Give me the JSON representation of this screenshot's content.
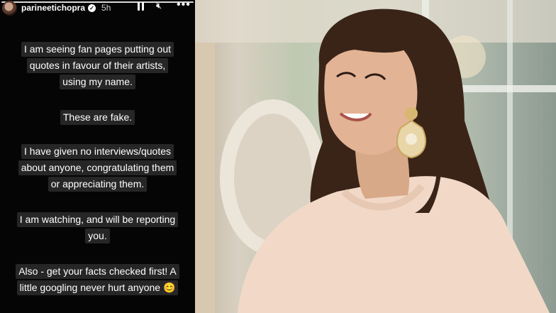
{
  "story": {
    "username": "parineetichopra",
    "time": "5h",
    "icons": [
      "verified-badge-icon",
      "pause-icon",
      "mute-icon",
      "more-icon"
    ],
    "lines": [
      "I am seeing fan pages putting out",
      "quotes in favour of their artists,",
      "using my name.",
      "These are fake.",
      "I have given no interviews/quotes",
      "about anyone, congratulating them",
      "or appreciating them.",
      "I am watching, and will be reporting",
      "you.",
      "Also - get your facts checked first! A",
      "little googling never hurt anyone 😊"
    ]
  },
  "colors": {
    "story_background": "#050505",
    "text_highlight": "#262626",
    "outfit": "#f2d9c7"
  }
}
